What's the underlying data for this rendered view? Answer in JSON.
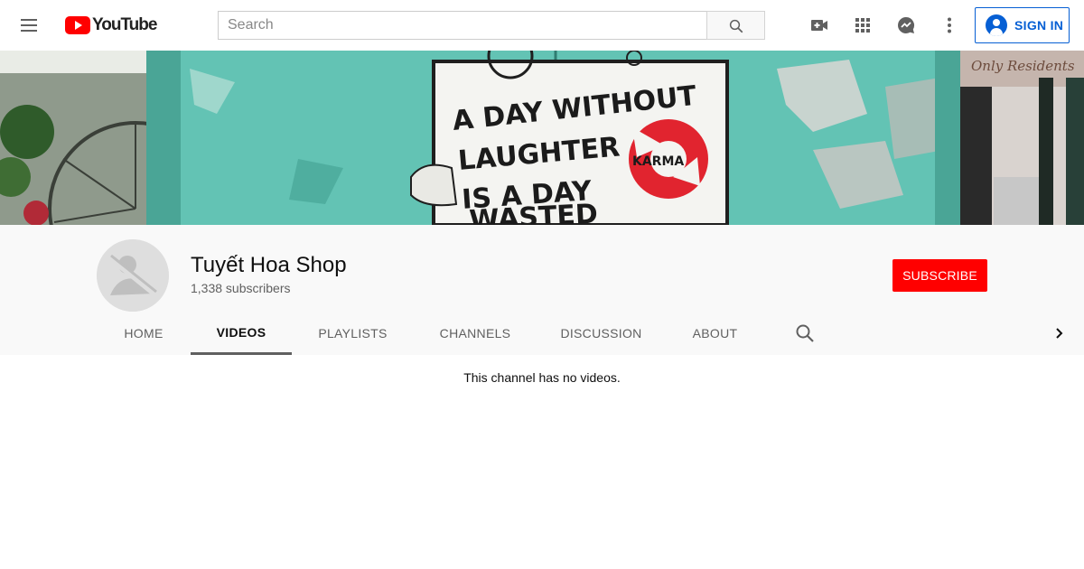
{
  "masthead": {
    "logo_text": "YouTube",
    "search_placeholder": "Search",
    "signin_label": "SIGN IN",
    "icons": [
      "menu-icon",
      "search-icon",
      "create-video-icon",
      "apps-icon",
      "messages-icon",
      "more-vert-icon",
      "account-icon"
    ]
  },
  "banner": {
    "sign_text": [
      "A DAY WITHOUT",
      "LAUGHTER",
      "IS A DAY",
      "WASTED"
    ],
    "badge_text": "KARMA",
    "corner_text": "Only Residents"
  },
  "channel": {
    "name": "Tuyết Hoa Shop",
    "subscribers": "1,338 subscribers",
    "subscribe_label": "SUBSCRIBE"
  },
  "tabs": [
    {
      "label": "HOME",
      "active": false
    },
    {
      "label": "VIDEOS",
      "active": true
    },
    {
      "label": "PLAYLISTS",
      "active": false
    },
    {
      "label": "CHANNELS",
      "active": false
    },
    {
      "label": "DISCUSSION",
      "active": false
    },
    {
      "label": "ABOUT",
      "active": false
    }
  ],
  "content": {
    "empty_message": "This channel has no videos."
  },
  "colors": {
    "brand_red": "#ff0000",
    "link_blue": "#065fd4",
    "header_bg": "#f9f9f9",
    "text_secondary": "#606060"
  }
}
